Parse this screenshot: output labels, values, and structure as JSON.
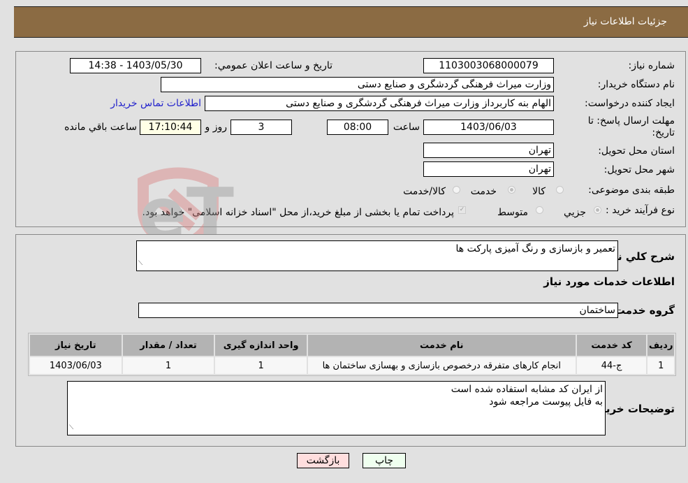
{
  "header": {
    "title": "جزئیات اطلاعات نیاز"
  },
  "form": {
    "need_number_label": "شماره نیاز:",
    "need_number": "1103003068000079",
    "announce_label": "تاريخ و ساعت اعلان عمومي:",
    "announce_value": "1403/05/30 - 14:38",
    "buyer_org_label": "نام دستگاه خريدار:",
    "buyer_org": "وزارت میراث فرهنگی  گردشگری و صنایع دستی",
    "creator_label": "ايجاد کننده درخواست:",
    "creator": "الهام بنه کاربرداز وزارت میراث فرهنگی  گردشگری و صنایع دستی",
    "contact_link": "اطلاعات تماس خريدار",
    "deadline_label": "مهلت ارسال پاسخ: تا تاریخ:",
    "deadline_date": "1403/06/03",
    "time_label": "ساعت",
    "deadline_time": "08:00",
    "days": "3",
    "days_label": "روز و",
    "remaining_time": "17:10:44",
    "remaining_label": "ساعت باقي مانده",
    "province_label": "استان محل تحویل:",
    "province": "تهران",
    "city_label": "شهر محل تحویل:",
    "city": "تهران",
    "category_label": "طبقه بندی موضوعی:",
    "category_options": [
      {
        "label": "کالا",
        "selected": false
      },
      {
        "label": "خدمت",
        "selected": true
      },
      {
        "label": "کالا/خدمت",
        "selected": false
      }
    ],
    "process_label": "نوع فرآیند خرید :",
    "process_options": [
      {
        "label": "جزيي",
        "selected": true
      },
      {
        "label": "متوسط",
        "selected": false
      }
    ],
    "payment_note": "پرداخت تمام يا بخشی از مبلغ خريد،از محل \"اسناد خزانه اسلامی\" خواهد بود.",
    "payment_checked": true
  },
  "details": {
    "general_desc_label": "شرح کلي نياز:",
    "general_desc": "تعمیر و بازسازی و رنگ آمیزی پارکت ها",
    "services_heading": "اطلاعات خدمات مورد نیاز",
    "service_group_label": "گروه خدمت:",
    "service_group": "ساختمان",
    "table": {
      "headers": [
        "رديف",
        "کد خدمت",
        "نام خدمت",
        "واحد اندازه گيری",
        "تعداد / مقدار",
        "تاريخ نياز"
      ],
      "rows": [
        [
          "1",
          "ج-44",
          "انجام کارهای متفرقه درخصوص بازسازی و بهسازی ساختمان ها",
          "1",
          "1",
          "1403/06/03"
        ]
      ]
    },
    "buyer_notes_label": "توضيحات خريدار:",
    "buyer_notes_line1": "از ایران کد مشابه استفاده شده است",
    "buyer_notes_line2": "به فایل پیوست مراجعه شود"
  },
  "buttons": {
    "print": "چاپ",
    "back": "بازگشت"
  },
  "colors": {
    "header_bg": "#8b6b43",
    "print_bg": "#efffef",
    "back_bg": "#ffdede",
    "link": "#2222cc"
  },
  "watermark": {
    "text": "AriaTender.neT"
  }
}
